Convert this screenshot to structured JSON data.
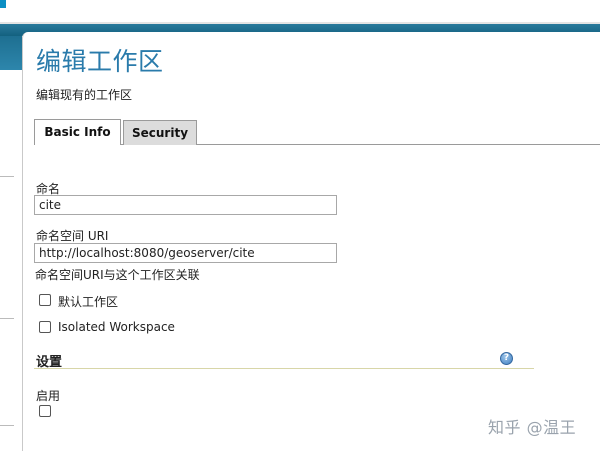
{
  "header": {
    "title": "编辑工作区",
    "subtitle": "编辑现有的工作区"
  },
  "tabs": [
    {
      "label": "Basic Info",
      "active": true
    },
    {
      "label": "Security",
      "active": false
    }
  ],
  "form": {
    "name_label": "命名",
    "name_value": "cite",
    "uri_label": "命名空间 URI",
    "uri_value": "http://localhost:8080/geoserver/cite",
    "uri_hint": "命名空间URI与这个工作区关联",
    "default_workspace_label": "默认工作区",
    "default_workspace_checked": false,
    "isolated_workspace_label": "Isolated Workspace",
    "isolated_workspace_checked": false
  },
  "settings": {
    "title": "设置",
    "help_icon": "help-icon",
    "enable_label": "启用",
    "enable_checked": false
  },
  "watermark": {
    "text": "知乎 @温王"
  },
  "colors": {
    "title": "#2a7bab",
    "band": "#13617f",
    "inactive_tab": "#dcdcdc"
  }
}
